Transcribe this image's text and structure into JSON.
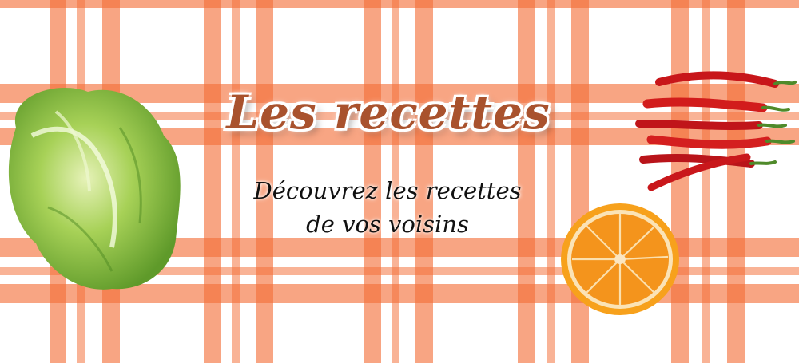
{
  "header": {
    "title": "Les recettes",
    "subtitle_line1": "Découvrez les recettes",
    "subtitle_line2": "de vos voisins"
  },
  "images": {
    "lettuce": "lettuce-image",
    "peppers": "chili-peppers-image",
    "orange": "orange-slice-image"
  },
  "colors": {
    "gingham": "#f46e37",
    "title": "#a9522d",
    "subtitle": "#111111"
  }
}
